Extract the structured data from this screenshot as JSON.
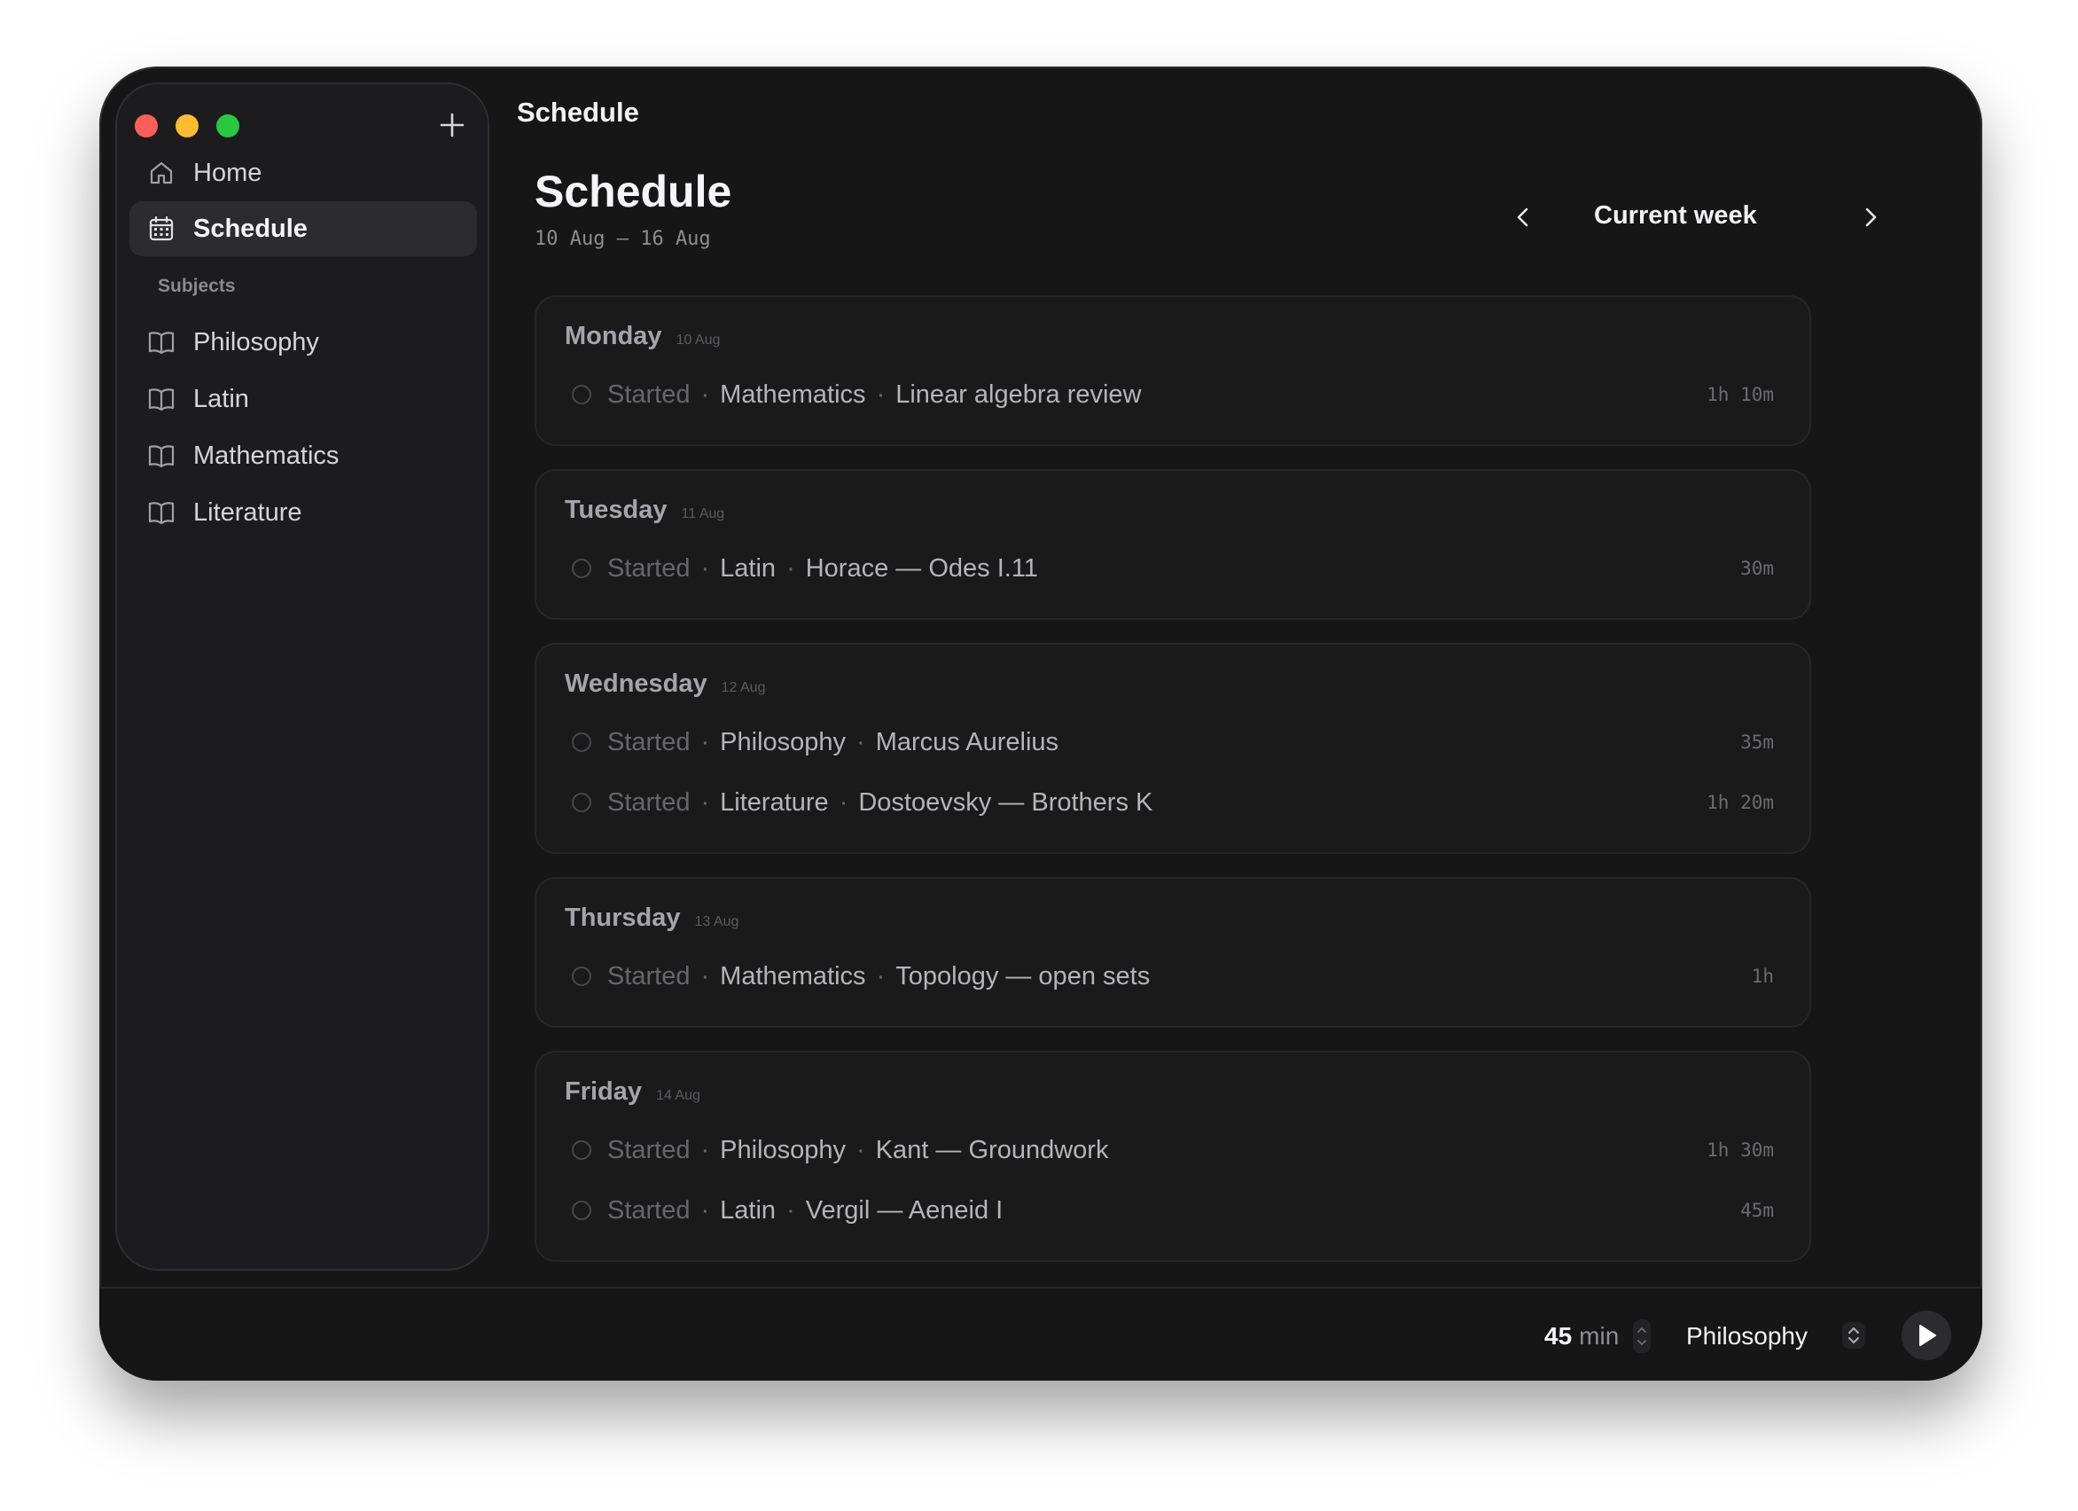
{
  "window": {
    "title": "Schedule"
  },
  "sidebar": {
    "nav": [
      {
        "label": "Home",
        "icon": "home-icon"
      },
      {
        "label": "Schedule",
        "icon": "calendar-icon",
        "active": true
      }
    ],
    "section_label": "Subjects",
    "subjects": [
      {
        "label": "Philosophy",
        "icon": "book-icon"
      },
      {
        "label": "Latin",
        "icon": "book-icon"
      },
      {
        "label": "Mathematics",
        "icon": "book-icon"
      },
      {
        "label": "Literature",
        "icon": "book-icon"
      }
    ]
  },
  "header": {
    "title": "Schedule",
    "date_range": "10 Aug – 16 Aug",
    "week_label": "Current week"
  },
  "days": [
    {
      "name": "Monday",
      "date": "10 Aug",
      "tasks": [
        {
          "status": "Started",
          "subject": "Mathematics",
          "title": "Linear algebra review",
          "duration": "1h 10m"
        }
      ]
    },
    {
      "name": "Tuesday",
      "date": "11 Aug",
      "tasks": [
        {
          "status": "Started",
          "subject": "Latin",
          "title": "Horace — Odes I.11",
          "duration": "30m"
        }
      ]
    },
    {
      "name": "Wednesday",
      "date": "12 Aug",
      "tasks": [
        {
          "status": "Started",
          "subject": "Philosophy",
          "title": "Marcus Aurelius",
          "duration": "35m"
        },
        {
          "status": "Started",
          "subject": "Literature",
          "title": "Dostoevsky — Brothers K",
          "duration": "1h 20m"
        }
      ]
    },
    {
      "name": "Thursday",
      "date": "13 Aug",
      "tasks": [
        {
          "status": "Started",
          "subject": "Mathematics",
          "title": "Topology — open sets",
          "duration": "1h"
        }
      ]
    },
    {
      "name": "Friday",
      "date": "14 Aug",
      "tasks": [
        {
          "status": "Started",
          "subject": "Philosophy",
          "title": "Kant — Groundwork",
          "duration": "1h 30m"
        },
        {
          "status": "Started",
          "subject": "Latin",
          "title": "Vergil — Aeneid I",
          "duration": "45m"
        }
      ]
    }
  ],
  "bottom_bar": {
    "minutes_value": "45",
    "minutes_unit": "min",
    "subject": "Philosophy"
  },
  "separator": "·",
  "colors": {
    "window_bg": "#161617",
    "sidebar_bg": "#1c1c1e",
    "card_bg": "#1a1a1b",
    "traffic_red": "#ff5f57",
    "traffic_yellow": "#febc2e",
    "traffic_green": "#28c840"
  }
}
